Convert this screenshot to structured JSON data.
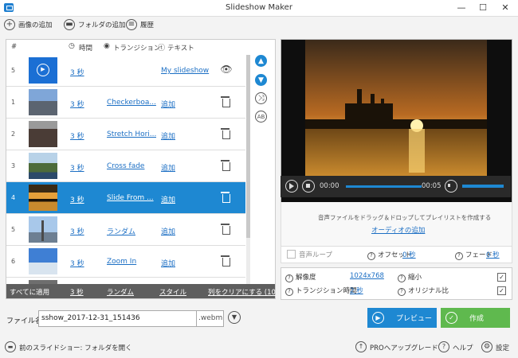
{
  "window": {
    "title": "Slideshow Maker",
    "minimize": "—",
    "maximize": "☐",
    "close": "✕"
  },
  "toolbar": {
    "add_images": "画像の追加",
    "add_folder": "フォルダの追加",
    "history": "履歴"
  },
  "list": {
    "headers": {
      "num": "#",
      "time": "時間",
      "transition": "トランジション",
      "text": "テキスト"
    },
    "rows": [
      {
        "num": "5",
        "time": "3 秒",
        "transition": "",
        "text": "My slideshow",
        "thumb": "title"
      },
      {
        "num": "1",
        "time": "3 秒",
        "transition": "Checkerboa...",
        "text": "追加",
        "thumb": "castle"
      },
      {
        "num": "2",
        "time": "3 秒",
        "transition": "Stretch Hori...",
        "text": "追加",
        "thumb": "city"
      },
      {
        "num": "3",
        "time": "3 秒",
        "transition": "Cross fade",
        "text": "追加",
        "thumb": "cliff"
      },
      {
        "num": "4",
        "time": "3 秒",
        "transition": "Slide From ...",
        "text": "追加",
        "thumb": "sunset"
      },
      {
        "num": "5",
        "time": "3 秒",
        "transition": "ランダム",
        "text": "追加",
        "thumb": "eiffel"
      },
      {
        "num": "6",
        "time": "3 秒",
        "transition": "Zoom In",
        "text": "追加",
        "thumb": "tower"
      }
    ],
    "side_buttons": {
      "up": "▲",
      "down": "▼",
      "shuffle": "⤨",
      "ab": "AB"
    },
    "footer": {
      "apply_all": "すべてに適用",
      "time": "3 秒",
      "transition": "ランダム",
      "style": "スタイル",
      "clear": "列をクリアにする (10"
    }
  },
  "player": {
    "current": "00:00",
    "total": "00:05"
  },
  "audio": {
    "hint": "音声ファイルをドラッグ＆ドロップしてプレイリストを作成する",
    "add_audio": "オーディオの追加"
  },
  "loop": {
    "label": "音声ループ",
    "offset_label": "オフセット",
    "offset_value": "0 秒",
    "fade_label": "フェード",
    "fade_value": "0 秒"
  },
  "settings": {
    "resolution_label": "解像度",
    "resolution_value": "1024x768",
    "shrink_label": "縮小",
    "transition_time_label": "トランジション時間",
    "transition_time_value": "2 秒",
    "original_ratio_label": "オリジナル比"
  },
  "file": {
    "label": "ファイル名",
    "name": "sshow_2017-12-31_151436",
    "ext": ".webm"
  },
  "buttons": {
    "preview": "プレビュー",
    "create": "作成"
  },
  "status": {
    "open_folder": "前のスライドショー: フォルダを開く",
    "upgrade": "PROへアップグレード",
    "help": "ヘルプ",
    "settings": "設定"
  },
  "colors": {
    "accent": "#1e88d2",
    "create": "#5fb94e"
  }
}
